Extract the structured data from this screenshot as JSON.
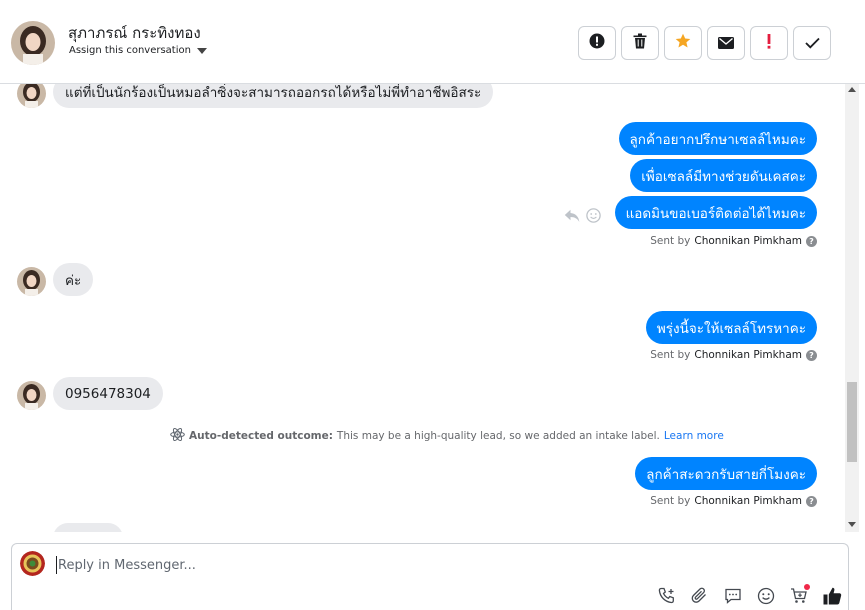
{
  "header": {
    "contact_name": "สุภาภรณ์ กระทิงทอง",
    "assign_label": "Assign this conversation",
    "actions": [
      {
        "name": "mark-spam-button",
        "icon": "alert-circle-icon"
      },
      {
        "name": "delete-button",
        "icon": "trash-icon"
      },
      {
        "name": "star-button",
        "icon": "star-icon"
      },
      {
        "name": "mark-unread-button",
        "icon": "envelope-icon"
      },
      {
        "name": "follow-up-button",
        "icon": "exclamation-icon"
      },
      {
        "name": "mark-done-button",
        "icon": "checkmark-icon"
      }
    ]
  },
  "messages": {
    "m1": "แต่ที่เป็นนักร้องเป็นหมอลำซิ่งจะสามารถออกรถได้หรือไม่พี่ทำอาชีพอิสระ",
    "m2": "ลูกค้าอยากปรึกษาเซลล์ไหมคะ",
    "m3": "เพื่อเซลล์มีทางช่วยดันเคสคะ",
    "m4": "แอดมินขอเบอร์ติดต่อได้ไหมคะ",
    "m5": "ค่ะ",
    "m6": "พรุ่งนี้จะให้เซลล์โทรหาคะ",
    "m7": "0956478304",
    "m8": "ลูกค้าสะดวกรับสายกี่โมงคะ"
  },
  "sent_by": {
    "prefix": "Sent by",
    "agent": "Chonnikan Pimkham"
  },
  "auto_detect": {
    "label": "Auto-detected outcome:",
    "text": "This may be a high-quality lead, so we added an intake label.",
    "link": "Learn more"
  },
  "composer": {
    "placeholder": "Reply in Messenger...",
    "tools": [
      "add-call-icon",
      "attachment-icon",
      "saved-reply-icon",
      "emoji-icon",
      "cart-icon",
      "thumbs-up-icon"
    ]
  },
  "colors": {
    "outgoing_bubble": "#0084ff",
    "incoming_bubble": "#e9eaed",
    "star": "#f5a623",
    "exclamation": "#e41e3f",
    "link": "#1876f2"
  }
}
